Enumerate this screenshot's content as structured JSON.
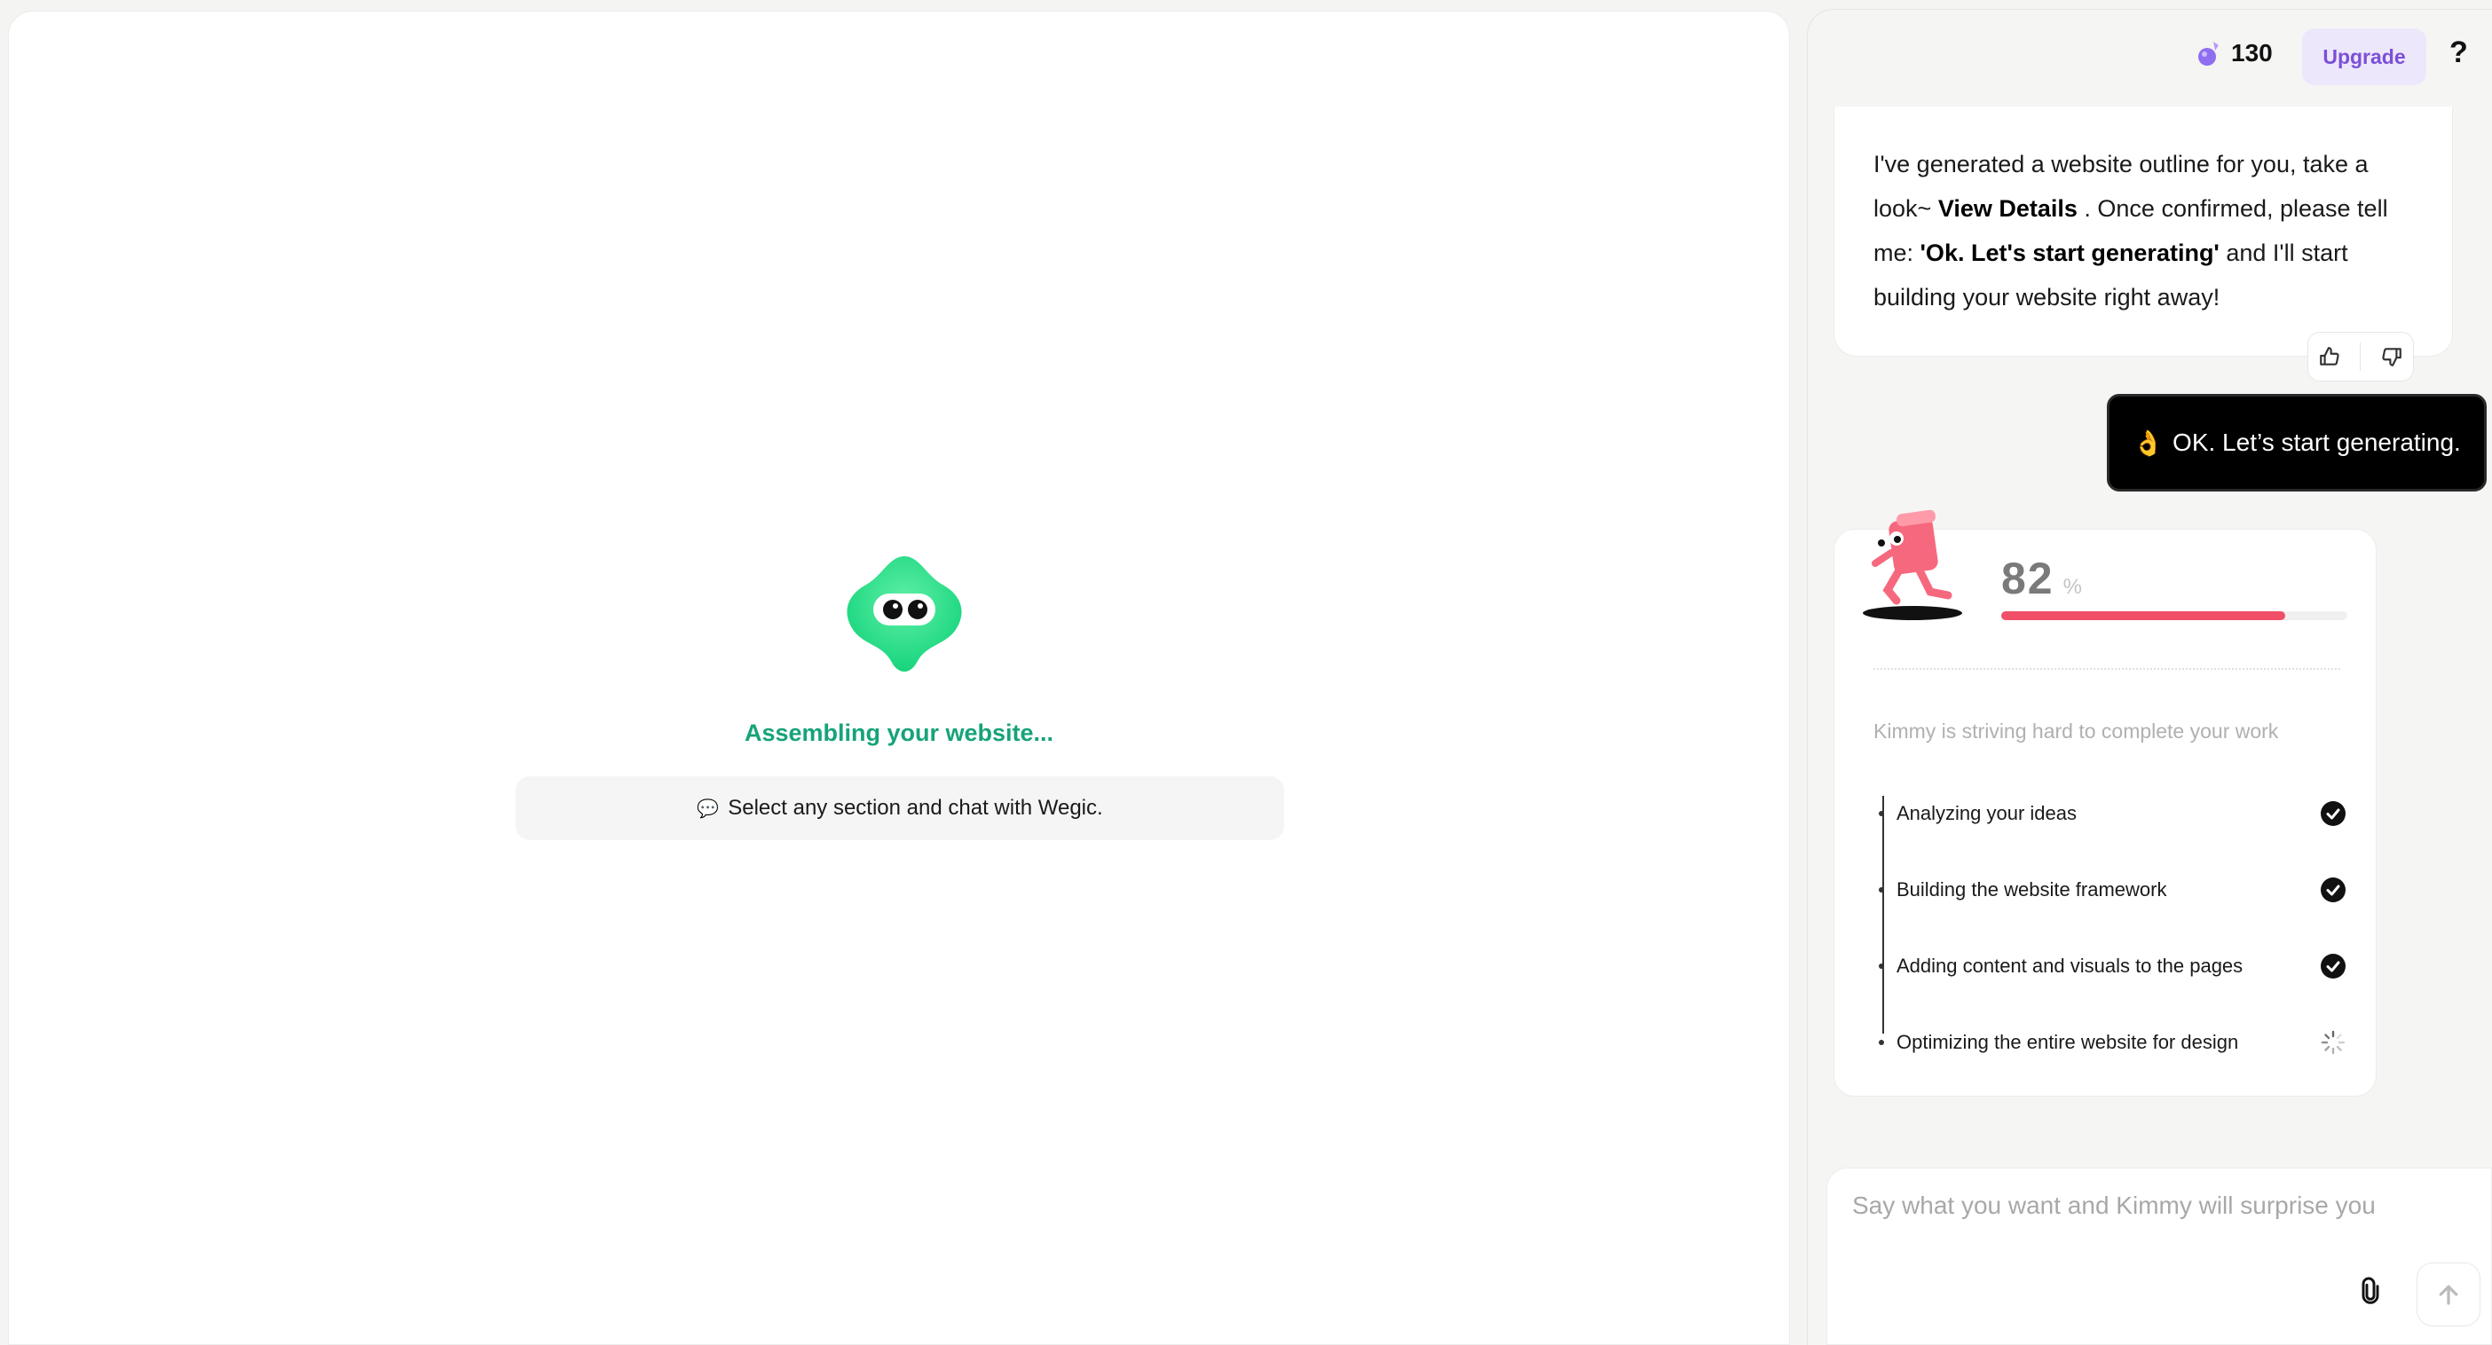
{
  "preview": {
    "status_text": "Assembling your website...",
    "hint_icon": "💬",
    "hint_text": "Select any section and chat with Wegic."
  },
  "header": {
    "credits_icon": "gem-icon",
    "credits": "130",
    "upgrade_label": "Upgrade",
    "help_label": "?"
  },
  "chat": {
    "ai_message": {
      "part1": "I've generated a website outline for you, take a look~ ",
      "link": "View Details",
      "part2": " . Once confirmed, please tell me: ",
      "quote": "'Ok. Let's start generating'",
      "part3": " and I'll start building your website right away!"
    },
    "user_message": {
      "emoji": "👌",
      "text": "OK. Let’s start generating."
    },
    "progress": {
      "percent": "82",
      "percent_symbol": "%",
      "fill_fraction": 0.82,
      "status_text": "Kimmy is striving hard to complete your work",
      "steps": [
        {
          "label": "Analyzing your ideas",
          "status": "done"
        },
        {
          "label": "Building the website framework",
          "status": "done"
        },
        {
          "label": "Adding content and visuals to the pages",
          "status": "done"
        },
        {
          "label": "Optimizing the entire website for design",
          "status": "loading"
        }
      ]
    },
    "composer": {
      "placeholder": "Say what you want and Kimmy will surprise you"
    }
  },
  "colors": {
    "accent_green": "#16a37a",
    "upgrade_bg": "#ede7fb",
    "upgrade_text": "#7b4fd8",
    "progress_fill": "#f04f67"
  }
}
